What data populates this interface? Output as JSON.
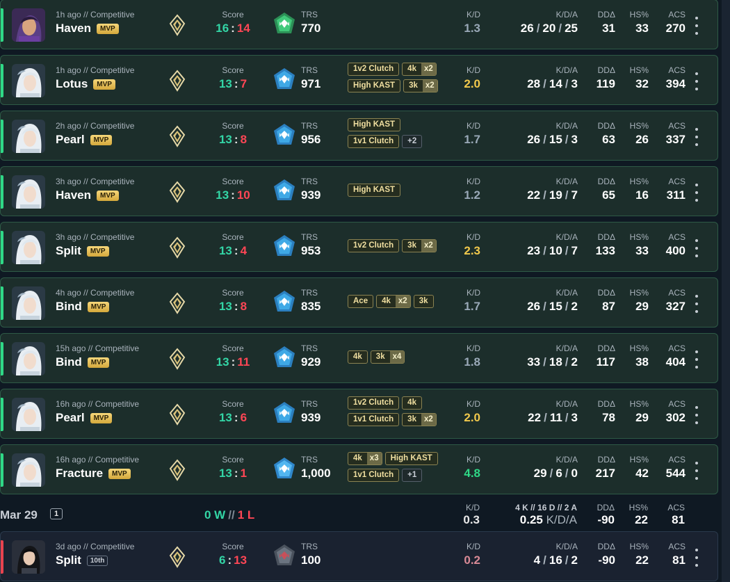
{
  "labels": {
    "score": "Score",
    "trs": "TRS",
    "kd": "K/D",
    "kda": "K/D/A",
    "dd": "DDΔ",
    "hs": "HS%",
    "acs": "ACS"
  },
  "colors": {
    "win": "#2fd987",
    "loss": "#e8434f",
    "kd_gold": "#f2c94c",
    "kd_green": "#2fd987",
    "kd_gray": "#9aa9b8",
    "kd_pink": "#d98a96"
  },
  "matches": [
    {
      "meta": "1h ago // Competitive",
      "map": "Haven",
      "badge": "MVP",
      "score_a": "16",
      "score_b": "14",
      "result": "win",
      "trs": "770",
      "trs_icon": "green-gem-icon",
      "kd": "1.3",
      "kd_color": "gray",
      "k": "26",
      "d": "20",
      "a": "25",
      "dd": "31",
      "hs": "33",
      "acs": "270",
      "agent": "agent-portrait-purple",
      "tags": []
    },
    {
      "meta": "1h ago // Competitive",
      "map": "Lotus",
      "badge": "MVP",
      "score_a": "13",
      "score_b": "7",
      "result": "win",
      "trs": "971",
      "trs_icon": "blue-gem-icon",
      "kd": "2.0",
      "kd_color": "gold",
      "k": "28",
      "d": "14",
      "a": "3",
      "dd": "119",
      "hs": "32",
      "acs": "394",
      "agent": "agent-portrait-white",
      "tags": [
        [
          {
            "t": "1v2 Clutch"
          },
          {
            "t": "4k",
            "m": "x2"
          }
        ],
        [
          {
            "t": "High KAST"
          },
          {
            "t": "3k",
            "m": "x2"
          }
        ]
      ]
    },
    {
      "meta": "2h ago // Competitive",
      "map": "Pearl",
      "badge": "MVP",
      "score_a": "13",
      "score_b": "8",
      "result": "win",
      "trs": "956",
      "trs_icon": "blue-gem-icon",
      "kd": "1.7",
      "kd_color": "gray",
      "k": "26",
      "d": "15",
      "a": "3",
      "dd": "63",
      "hs": "26",
      "acs": "337",
      "agent": "agent-portrait-white",
      "tags": [
        [
          {
            "t": "High KAST"
          }
        ],
        [
          {
            "t": "1v1 Clutch"
          },
          {
            "t": "+2",
            "more": true
          }
        ]
      ]
    },
    {
      "meta": "3h ago // Competitive",
      "map": "Haven",
      "badge": "MVP",
      "score_a": "13",
      "score_b": "10",
      "result": "win",
      "trs": "939",
      "trs_icon": "blue-gem-icon",
      "kd": "1.2",
      "kd_color": "gray",
      "k": "22",
      "d": "19",
      "a": "7",
      "dd": "65",
      "hs": "16",
      "acs": "311",
      "agent": "agent-portrait-white",
      "tags": [
        [
          {
            "t": "High KAST"
          }
        ]
      ]
    },
    {
      "meta": "3h ago // Competitive",
      "map": "Split",
      "badge": "MVP",
      "score_a": "13",
      "score_b": "4",
      "result": "win",
      "trs": "953",
      "trs_icon": "blue-gem-icon",
      "kd": "2.3",
      "kd_color": "gold",
      "k": "23",
      "d": "10",
      "a": "7",
      "dd": "133",
      "hs": "33",
      "acs": "400",
      "agent": "agent-portrait-white",
      "tags": [
        [
          {
            "t": "1v2 Clutch"
          },
          {
            "t": "3k",
            "m": "x2"
          }
        ]
      ]
    },
    {
      "meta": "4h ago // Competitive",
      "map": "Bind",
      "badge": "MVP",
      "score_a": "13",
      "score_b": "8",
      "result": "win",
      "trs": "835",
      "trs_icon": "blue-gem-icon",
      "kd": "1.7",
      "kd_color": "gray",
      "k": "26",
      "d": "15",
      "a": "2",
      "dd": "87",
      "hs": "29",
      "acs": "327",
      "agent": "agent-portrait-white",
      "tags": [
        [
          {
            "t": "Ace"
          },
          {
            "t": "4k",
            "m": "x2"
          },
          {
            "t": "3k"
          }
        ]
      ]
    },
    {
      "meta": "15h ago // Competitive",
      "map": "Bind",
      "badge": "MVP",
      "score_a": "13",
      "score_b": "11",
      "result": "win",
      "trs": "929",
      "trs_icon": "blue-gem-icon",
      "kd": "1.8",
      "kd_color": "gray",
      "k": "33",
      "d": "18",
      "a": "2",
      "dd": "117",
      "hs": "38",
      "acs": "404",
      "agent": "agent-portrait-white",
      "tags": [
        [
          {
            "t": "4k"
          },
          {
            "t": "3k",
            "m": "x4"
          }
        ]
      ]
    },
    {
      "meta": "16h ago // Competitive",
      "map": "Pearl",
      "badge": "MVP",
      "score_a": "13",
      "score_b": "6",
      "result": "win",
      "trs": "939",
      "trs_icon": "blue-gem-icon",
      "kd": "2.0",
      "kd_color": "gold",
      "k": "22",
      "d": "11",
      "a": "3",
      "dd": "78",
      "hs": "29",
      "acs": "302",
      "agent": "agent-portrait-white",
      "tags": [
        [
          {
            "t": "1v2 Clutch"
          },
          {
            "t": "4k"
          }
        ],
        [
          {
            "t": "1v1 Clutch"
          },
          {
            "t": "3k",
            "m": "x2"
          }
        ]
      ]
    },
    {
      "meta": "16h ago // Competitive",
      "map": "Fracture",
      "badge": "MVP",
      "score_a": "13",
      "score_b": "1",
      "result": "win",
      "trs": "1,000",
      "trs_icon": "max-gem-icon",
      "kd": "4.8",
      "kd_color": "green",
      "k": "29",
      "d": "6",
      "a": "0",
      "dd": "217",
      "hs": "42",
      "acs": "544",
      "agent": "agent-portrait-white",
      "tags": [
        [
          {
            "t": "4k",
            "m": "x3"
          },
          {
            "t": "High KAST"
          }
        ],
        [
          {
            "t": "1v1 Clutch"
          },
          {
            "t": "+1",
            "more": true
          }
        ]
      ]
    }
  ],
  "day": {
    "date": "Mar 29",
    "count": "1",
    "wins": "0 W",
    "sep": "//",
    "losses": "1 L",
    "kd_label": "K/D",
    "kd": "0.3",
    "kda_label": "4 K // 16 D // 2 A",
    "kda_value": "0.25",
    "kda_unit": "K/D/A",
    "dd": "-90",
    "hs": "22",
    "acs": "81"
  },
  "last": {
    "meta": "3d ago // Competitive",
    "map": "Split",
    "badge": "10th",
    "score_a": "6",
    "score_b": "13",
    "result": "loss",
    "trs": "100",
    "trs_icon": "gray-gem-icon",
    "kd": "0.2",
    "kd_color": "pink",
    "k": "4",
    "d": "16",
    "a": "2",
    "dd": "-90",
    "hs": "22",
    "acs": "81",
    "agent": "agent-portrait-dark",
    "tags": []
  }
}
